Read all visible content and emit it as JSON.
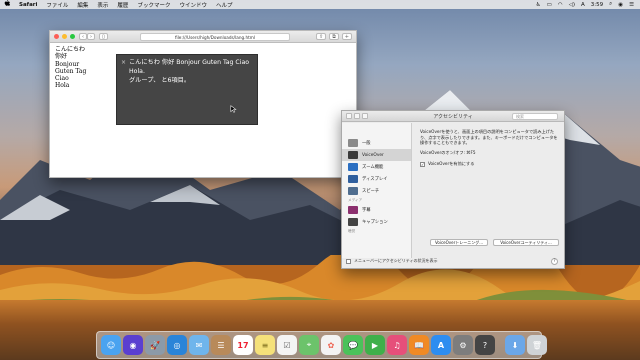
{
  "menubar": {
    "apple": "",
    "app": "Safari",
    "items": [
      "ファイル",
      "編集",
      "表示",
      "履歴",
      "ブックマーク",
      "ウインドウ",
      "ヘルプ"
    ],
    "clock": "3:59",
    "right_icons": [
      "voiceover-icon",
      "airplay-icon",
      "wifi-icon",
      "volume-icon",
      "input-menu-icon",
      "search-icon",
      "siri-icon",
      "notification-icon"
    ]
  },
  "safari": {
    "url": "file:///Users/high/Downloads/lang.html",
    "page_lines": [
      "こんにちわ",
      "你好",
      "Bonjour",
      "Guten Tag",
      "Ciao",
      "Hola"
    ]
  },
  "voiceover_panel": {
    "close": "×",
    "line1": "こんにちわ 你好 Bonjour Guten Tag Ciao Hola.",
    "line2": "グループ、 と6項目。"
  },
  "prefs": {
    "title": "アクセシビリティ",
    "search_placeholder": "検索",
    "sidebar": [
      {
        "label": "一般",
        "color": "#8a8a8a",
        "selected": false
      },
      {
        "label": "VoiceOver",
        "color": "#3a3a3a",
        "selected": true
      },
      {
        "label": "ズーム機能",
        "color": "#2b6fc2",
        "selected": false
      },
      {
        "label": "ディスプレイ",
        "color": "#2f5f9e",
        "selected": false
      },
      {
        "label": "スピーチ",
        "color": "#4f6d8f",
        "selected": false
      }
    ],
    "section_media": "メディア",
    "sidebar2": [
      {
        "label": "字幕",
        "color": "#8b2f6e"
      },
      {
        "label": "キャプション",
        "color": "#444444"
      }
    ],
    "section_hearing": "聴覚",
    "description": "VoiceOverを使うと、画面上の項目の説明をコンピュータで読み上げたり、点字で表示したりできます。また、キーボードだけでコンピュータを操作することもできます。",
    "toggle_hint": "VoiceOverのオン/オフ: ⌘F5",
    "enable_label": "VoiceOverを有効にする",
    "btn_training": "VoiceOverトレーニング...",
    "btn_utility": "VoiceOverユーティリティ...",
    "footer": "メニューバーにアクセシビリティの状況を表示",
    "help": "?"
  },
  "dock": {
    "apps": [
      {
        "name": "finder",
        "color": "#4aa3f0",
        "glyph": "☺"
      },
      {
        "name": "siri",
        "color": "#5a3fd0",
        "glyph": "◉"
      },
      {
        "name": "launchpad",
        "color": "#8c9aa8",
        "glyph": "🚀"
      },
      {
        "name": "safari",
        "color": "#2a84d8",
        "glyph": "◎"
      },
      {
        "name": "mail",
        "color": "#6fb5ec",
        "glyph": "✉"
      },
      {
        "name": "contacts",
        "color": "#b88a5a",
        "glyph": "☰"
      },
      {
        "name": "calendar",
        "color": "#ffffff",
        "glyph": "17"
      },
      {
        "name": "notes",
        "color": "#f5e17a",
        "glyph": "≡"
      },
      {
        "name": "reminders",
        "color": "#f4f4f4",
        "glyph": "☑"
      },
      {
        "name": "maps",
        "color": "#6cc36b",
        "glyph": "⌖"
      },
      {
        "name": "photos",
        "color": "#f3f3f3",
        "glyph": "✿"
      },
      {
        "name": "messages",
        "color": "#4bc25a",
        "glyph": "💬"
      },
      {
        "name": "facetime",
        "color": "#3fb04a",
        "glyph": "▶"
      },
      {
        "name": "itunes",
        "color": "#e64f7a",
        "glyph": "♫"
      },
      {
        "name": "ibooks",
        "color": "#f08a24",
        "glyph": "📖"
      },
      {
        "name": "app-store",
        "color": "#2d8df0",
        "glyph": "A"
      },
      {
        "name": "system-preferences",
        "color": "#7d7d7d",
        "glyph": "⚙"
      },
      {
        "name": "accessibility-inspector",
        "color": "#444444",
        "glyph": "?"
      }
    ],
    "right": [
      {
        "name": "downloads-folder",
        "color": "#6ba7e8",
        "glyph": "⬇"
      },
      {
        "name": "trash",
        "color": "#cfd3d6",
        "glyph": "🗑"
      }
    ]
  }
}
